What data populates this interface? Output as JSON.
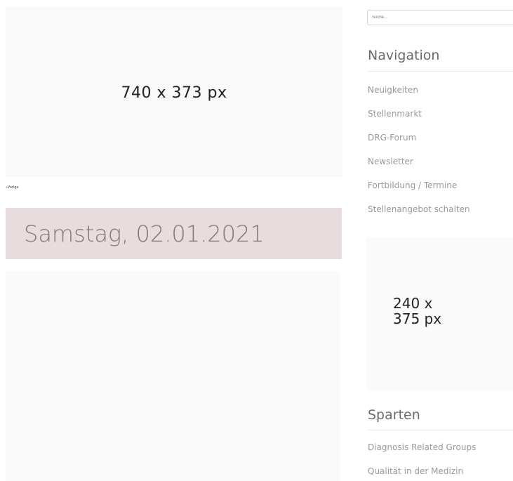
{
  "main": {
    "top_banner_text": "740 x 373 px",
    "tiny_label": "«Vorige",
    "date": "Samstag, 02.01.2021"
  },
  "sidebar": {
    "search_placeholder": "Suche...",
    "navigation_title": "Navigation",
    "navigation_items": [
      "Neuigkeiten",
      "Stellenmarkt",
      "DRG-Forum",
      "Newsletter",
      "Fortbildung / Termine",
      "Stellenangebot schalten"
    ],
    "banner_text_line1": "240 x",
    "banner_text_line2": "375 px",
    "sparten_title": "Sparten",
    "sparten_items": [
      "Diagnosis Related Groups",
      "Qualität in der Medizin"
    ]
  }
}
